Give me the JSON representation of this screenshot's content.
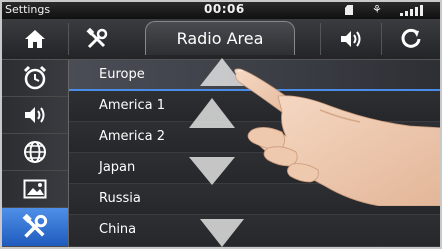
{
  "status": {
    "app_title": "Settings",
    "time": "00:06",
    "usb_glyph": "⚘"
  },
  "topbar": {
    "title": "Radio Area"
  },
  "sidebar": {
    "items": [
      {
        "icon": "alarm-clock-icon"
      },
      {
        "icon": "speaker-icon"
      },
      {
        "icon": "globe-icon"
      },
      {
        "icon": "picture-icon"
      },
      {
        "icon": "tools-icon",
        "active": true
      }
    ]
  },
  "regions": [
    "Europe",
    "America 1",
    "America 2",
    "Japan",
    "Russia",
    "China"
  ],
  "selected_region": "Europe",
  "colors": {
    "accent": "#3f7fe0",
    "background": "#2a2b2e"
  }
}
